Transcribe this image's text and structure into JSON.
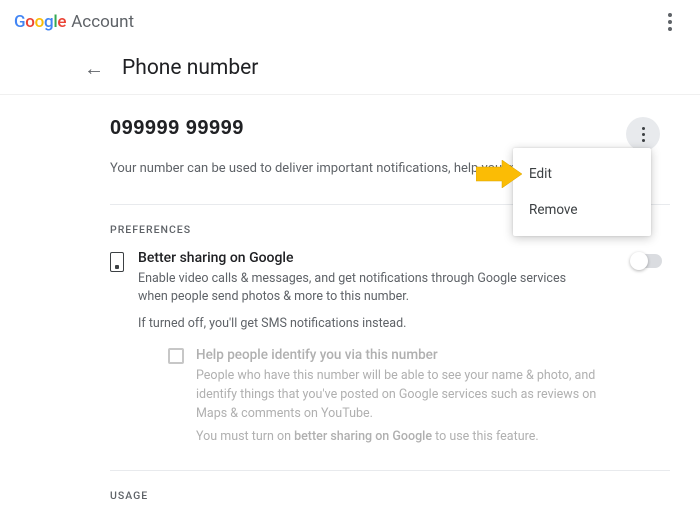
{
  "header": {
    "brand": "Google",
    "product": "Account"
  },
  "page": {
    "title": "Phone number"
  },
  "phone": {
    "number": "099999 99999",
    "description": "Your number can be used to deliver important notifications, help you more"
  },
  "menu": {
    "edit": "Edit",
    "remove": "Remove"
  },
  "sections": {
    "preferences_label": "PREFERENCES",
    "usage_label": "USAGE"
  },
  "pref": {
    "title": "Better sharing on Google",
    "desc": "Enable video calls & messages, and get notifications through Google services when people send photos & more to this number.",
    "desc2": "If turned off, you'll get SMS notifications instead."
  },
  "sub": {
    "title": "Help people identify you via this number",
    "desc": "People who have this number will be able to see your name & photo, and identify things that you've posted on Google services such as reviews on Maps & comments on YouTube.",
    "note_pre": "You must turn on ",
    "note_bold": "better sharing on Google",
    "note_post": " to use this feature."
  }
}
